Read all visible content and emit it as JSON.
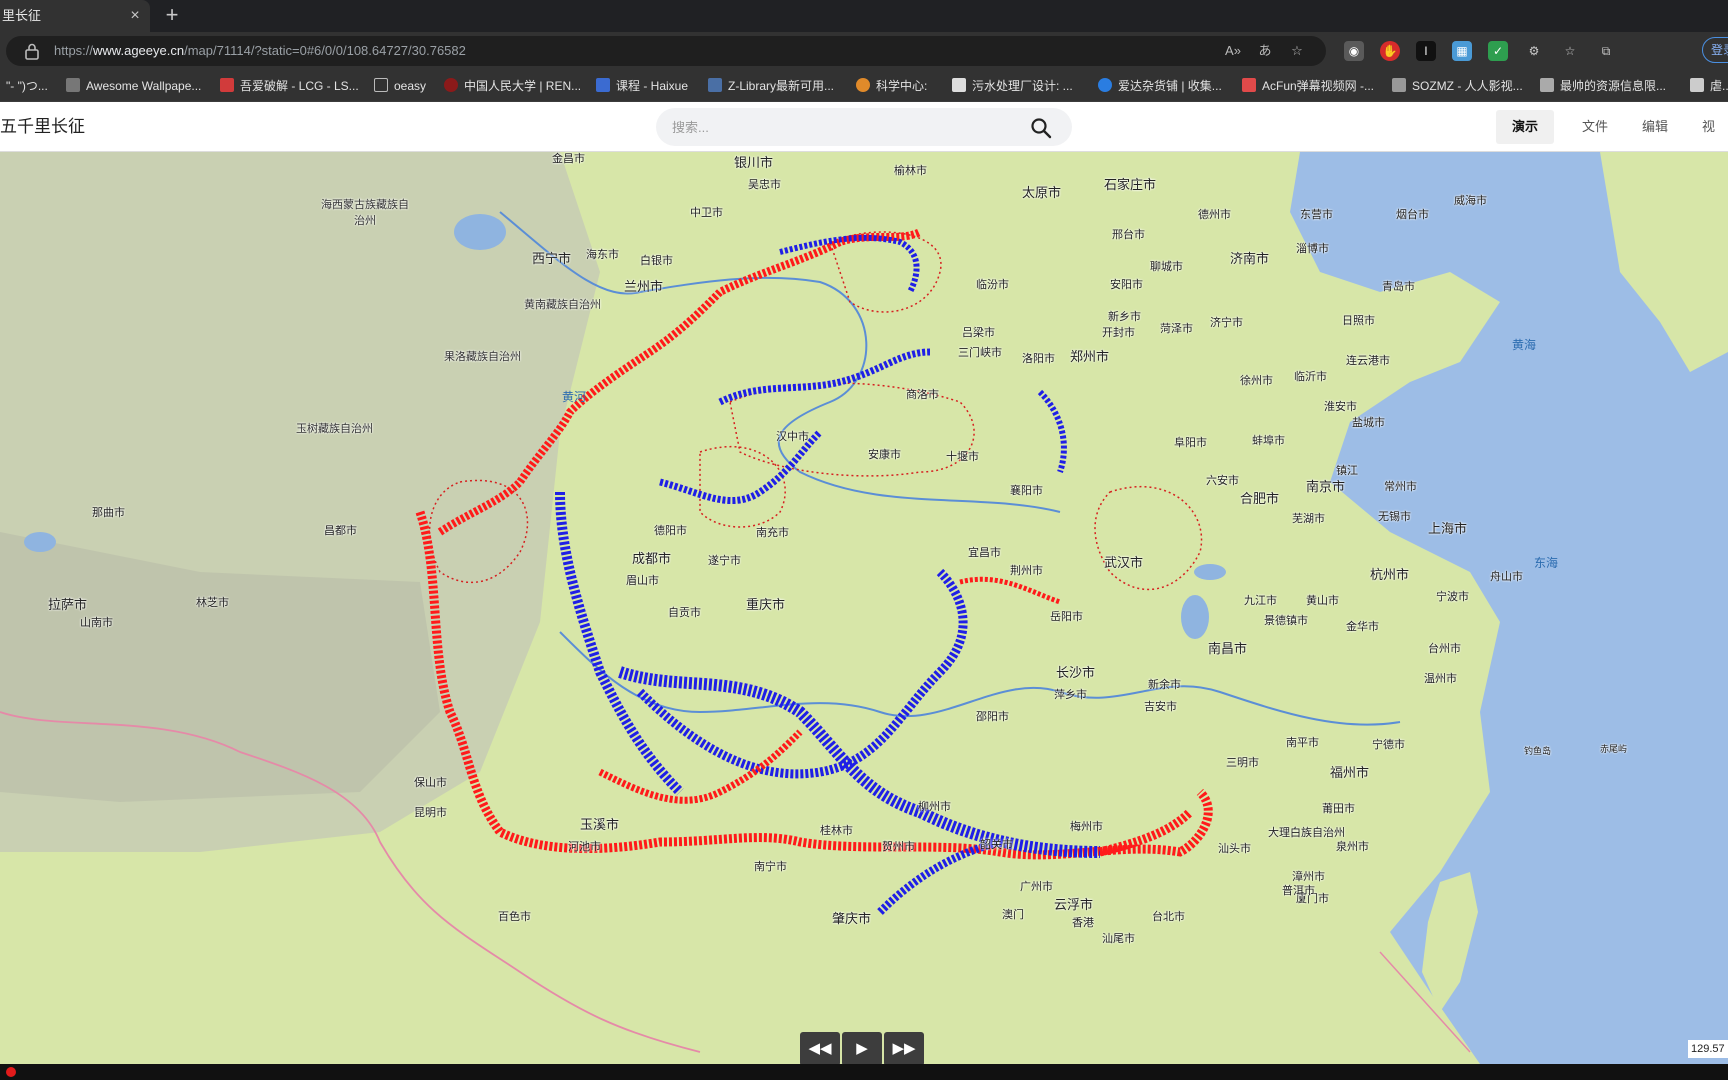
{
  "browser": {
    "tab_title": "里长征",
    "tab_close": "×",
    "new_tab": "+",
    "url_prefix": "https://",
    "url_host": "www.ageeye.cn",
    "url_path": "/map/71114/?static=0#6/0/0/108.64727/30.76582",
    "login_label": "登录",
    "bookmarks": [
      {
        "label": "\"- \")つ...",
        "color": "#888888"
      },
      {
        "label": "Awesome Wallpape...",
        "color": "#777777"
      },
      {
        "label": "吾爱破解 - LCG - LS...",
        "color": "#d13b3b"
      },
      {
        "label": "oeasy",
        "color": "#555555"
      },
      {
        "label": "中国人民大学 | REN...",
        "color": "#8b1a1a"
      },
      {
        "label": "课程 - Haixue",
        "color": "#3b6bd1"
      },
      {
        "label": "Z-Library最新可用...",
        "color": "#4a6fa5"
      },
      {
        "label": "科学中心:",
        "color": "#e08a2a"
      },
      {
        "label": "污水处理厂设计: ...",
        "color": "#dddddd"
      },
      {
        "label": "爱达杂货铺 | 收集...",
        "color": "#2a7de1"
      },
      {
        "label": "AcFun弹幕视频网 -...",
        "color": "#e14a4a"
      },
      {
        "label": "SOZMZ - 人人影视...",
        "color": "#999999"
      },
      {
        "label": "最帅的资源信息限...",
        "color": "#aaaaaa"
      },
      {
        "label": "虐...",
        "color": "#cccccc"
      }
    ]
  },
  "app": {
    "title": "五千里长征",
    "search_placeholder": "搜索...",
    "menus": [
      "演示",
      "文件",
      "编辑",
      "视图"
    ]
  },
  "map": {
    "route_colors": {
      "red_army_route": "#ff1a1a",
      "blue_marks": "#1f1fe6",
      "dotted_area": "#d62020"
    },
    "cities": [
      "金昌市",
      "银川市",
      "榆林市",
      "太原市",
      "石家庄市",
      "德州市",
      "东营市",
      "威海市",
      "烟台市",
      "海西蒙古族藏族自治州",
      "西宁市",
      "海东市",
      "白银市",
      "兰州市",
      "中卫市",
      "吴忠市",
      "吕梁市",
      "邢台市",
      "济南市",
      "淄博市",
      "聊城市",
      "黄南藏族自治州",
      "临汾市",
      "安阳市",
      "青岛市",
      "日照市",
      "新乡市",
      "开封市",
      "菏泽市",
      "济宁市",
      "果洛藏族自治州",
      "三门峡市",
      "洛阳市",
      "郑州市",
      "临沂市",
      "连云港市",
      "徐州市",
      "玉树藏族自治州",
      "商洛市",
      "阜阳市",
      "蚌埠市",
      "盐城市",
      "汉中市",
      "十堰市",
      "淮安市",
      "安康市",
      "那曲市",
      "昌都市",
      "南充市",
      "襄阳市",
      "六安市",
      "合肥市",
      "南京市",
      "镇江",
      "常州市",
      "芜湖市",
      "无锡市",
      "上海市",
      "德阳市",
      "遂宁市",
      "宜昌市",
      "荆州市",
      "武汉市",
      "杭州市",
      "九江市",
      "成都市",
      "眉山市",
      "宁波市",
      "舟山市",
      "黄山市",
      "拉萨市",
      "林芝市",
      "山南市",
      "自贡市",
      "重庆市",
      "岳阳市",
      "景德镇市",
      "金华市",
      "南昌市",
      "台州市",
      "温州市",
      "长沙市",
      "新余市",
      "萍乡市",
      "吉安市",
      "邵阳市",
      "南平市",
      "福州市",
      "宁德市",
      "三明市",
      "莆田市",
      "泉州市",
      "漳州市",
      "厦门市",
      "大理白族自治州",
      "保山市",
      "昆明市",
      "玉溪市",
      "河池市",
      "桂林市",
      "柳州市",
      "贺州市",
      "韶关市",
      "梅州市",
      "汕头市",
      "普洱市",
      "百色市",
      "南宁市",
      "肇庆市",
      "广州市",
      "云浮市",
      "澳门",
      "香港",
      "汕尾市",
      "台北市"
    ],
    "seas": [
      "黄海",
      "东海"
    ],
    "rivers": [
      "黄河"
    ],
    "islands": [
      "钓鱼岛",
      "赤尾屿"
    ],
    "scale_readout": "129.57"
  },
  "player": {
    "rewind": "◀◀",
    "play": "▶",
    "forward": "▶▶"
  }
}
